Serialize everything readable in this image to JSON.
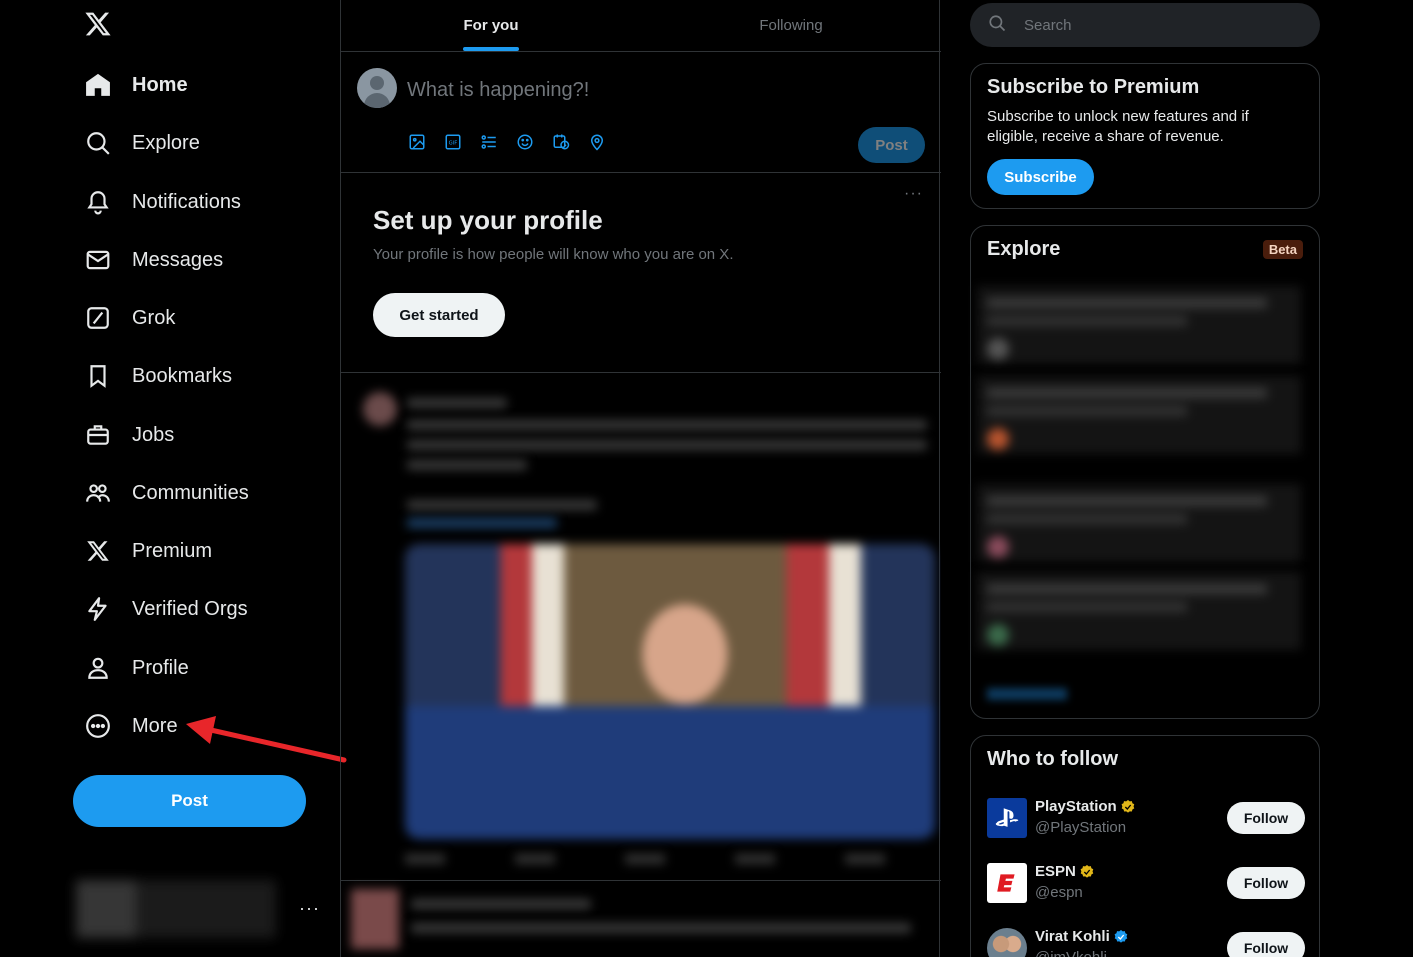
{
  "sidebar": {
    "items": [
      {
        "label": "Home",
        "icon": "home-icon"
      },
      {
        "label": "Explore",
        "icon": "search-icon"
      },
      {
        "label": "Notifications",
        "icon": "bell-icon"
      },
      {
        "label": "Messages",
        "icon": "envelope-icon"
      },
      {
        "label": "Grok",
        "icon": "grok-icon"
      },
      {
        "label": "Bookmarks",
        "icon": "bookmark-icon"
      },
      {
        "label": "Jobs",
        "icon": "briefcase-icon"
      },
      {
        "label": "Communities",
        "icon": "people-icon"
      },
      {
        "label": "Premium",
        "icon": "x-logo-icon"
      },
      {
        "label": "Verified Orgs",
        "icon": "lightning-icon"
      },
      {
        "label": "Profile",
        "icon": "person-icon"
      },
      {
        "label": "More",
        "icon": "more-circle-icon"
      }
    ],
    "post_label": "Post",
    "account_more": "···"
  },
  "header": {
    "tabs": [
      {
        "label": "For you",
        "active": true
      },
      {
        "label": "Following",
        "active": false
      }
    ]
  },
  "composer": {
    "placeholder": "What is happening?!",
    "post_label": "Post",
    "tools": [
      "image-icon",
      "gif-icon",
      "poll-icon",
      "emoji-icon",
      "schedule-icon",
      "location-icon"
    ]
  },
  "setup_profile": {
    "title": "Set up your profile",
    "subtitle": "Your profile is how people will know who you are on X.",
    "button": "Get started",
    "more": "···"
  },
  "right": {
    "search_placeholder": "Search",
    "premium": {
      "title": "Subscribe to Premium",
      "text": "Subscribe to unlock new features and if eligible, receive a share of revenue.",
      "button": "Subscribe"
    },
    "explore": {
      "title": "Explore",
      "badge": "Beta"
    },
    "who_to_follow": {
      "title": "Who to follow",
      "accounts": [
        {
          "name": "PlayStation",
          "handle": "@PlayStation",
          "badge": "gold",
          "button": "Follow"
        },
        {
          "name": "ESPN",
          "handle": "@espn",
          "badge": "gold",
          "button": "Follow"
        },
        {
          "name": "Virat Kohli",
          "handle": "@imVkohli",
          "badge": "blue",
          "button": "Follow"
        }
      ]
    }
  },
  "colors": {
    "accent": "#1d9bf0",
    "background": "#000000",
    "border": "#2f3336",
    "muted_text": "#71767b",
    "annotation_arrow": "#e8262a"
  }
}
